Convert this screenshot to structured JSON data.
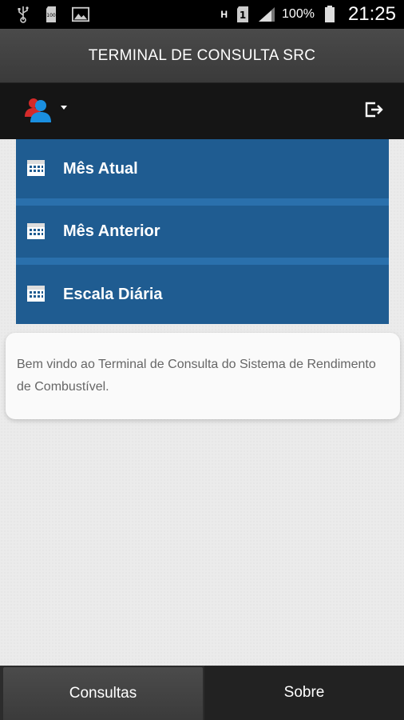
{
  "status_bar": {
    "icons_left": [
      "usb-icon",
      "sd-card-icon",
      "image-icon"
    ],
    "network_h": "H",
    "sim_slot": "1",
    "battery_percent": "100%",
    "time": "21:25"
  },
  "header": {
    "title": "TERMINAL DE CONSULTA SRC"
  },
  "action_bar": {
    "user_icon": "user-icon",
    "logout_icon": "logout-icon"
  },
  "menu": {
    "items": [
      {
        "label": "Mês Atual",
        "icon": "calendar-icon"
      },
      {
        "label": "Mês Anterior",
        "icon": "calendar-icon"
      },
      {
        "label": "Escala Diária",
        "icon": "calendar-icon"
      }
    ]
  },
  "welcome": {
    "text": "Bem vindo ao Terminal de Consulta do Sistema de Rendimento de Combustível."
  },
  "tabs": [
    {
      "label": "Consultas",
      "active": true
    },
    {
      "label": "Sobre",
      "active": false
    }
  ],
  "colors": {
    "menu_bg": "#1f5c91",
    "menu_separator": "#2a70ac",
    "header_bg": "#3f3f3f",
    "action_bar_bg": "#151515",
    "user_icon_red": "#d42a2a",
    "user_icon_blue": "#1a8fe0"
  }
}
